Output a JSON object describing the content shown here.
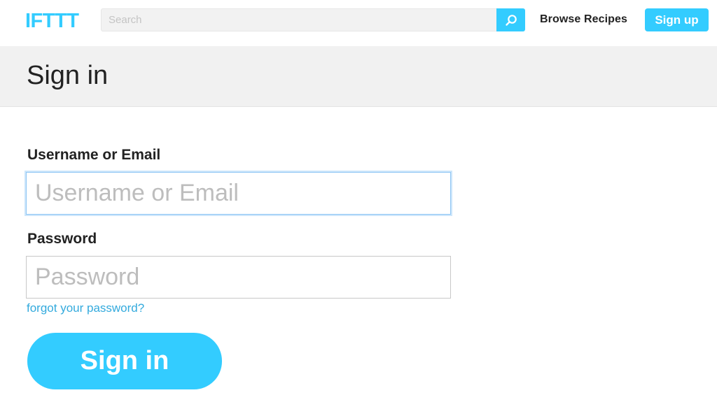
{
  "header": {
    "logo_text": "IFTTT",
    "search": {
      "placeholder": "Search",
      "value": ""
    },
    "browse_label": "Browse Recipes",
    "signup_label": "Sign up"
  },
  "page": {
    "title": "Sign in"
  },
  "form": {
    "username": {
      "label": "Username or Email",
      "placeholder": "Username or Email",
      "value": ""
    },
    "password": {
      "label": "Password",
      "placeholder": "Password",
      "value": ""
    },
    "forgot_label": "forgot your password?",
    "submit_label": "Sign in"
  },
  "icons": {
    "search": "search-icon"
  },
  "colors": {
    "brand": "#33ccff",
    "link": "#33aadd",
    "band": "#f1f1f1"
  }
}
